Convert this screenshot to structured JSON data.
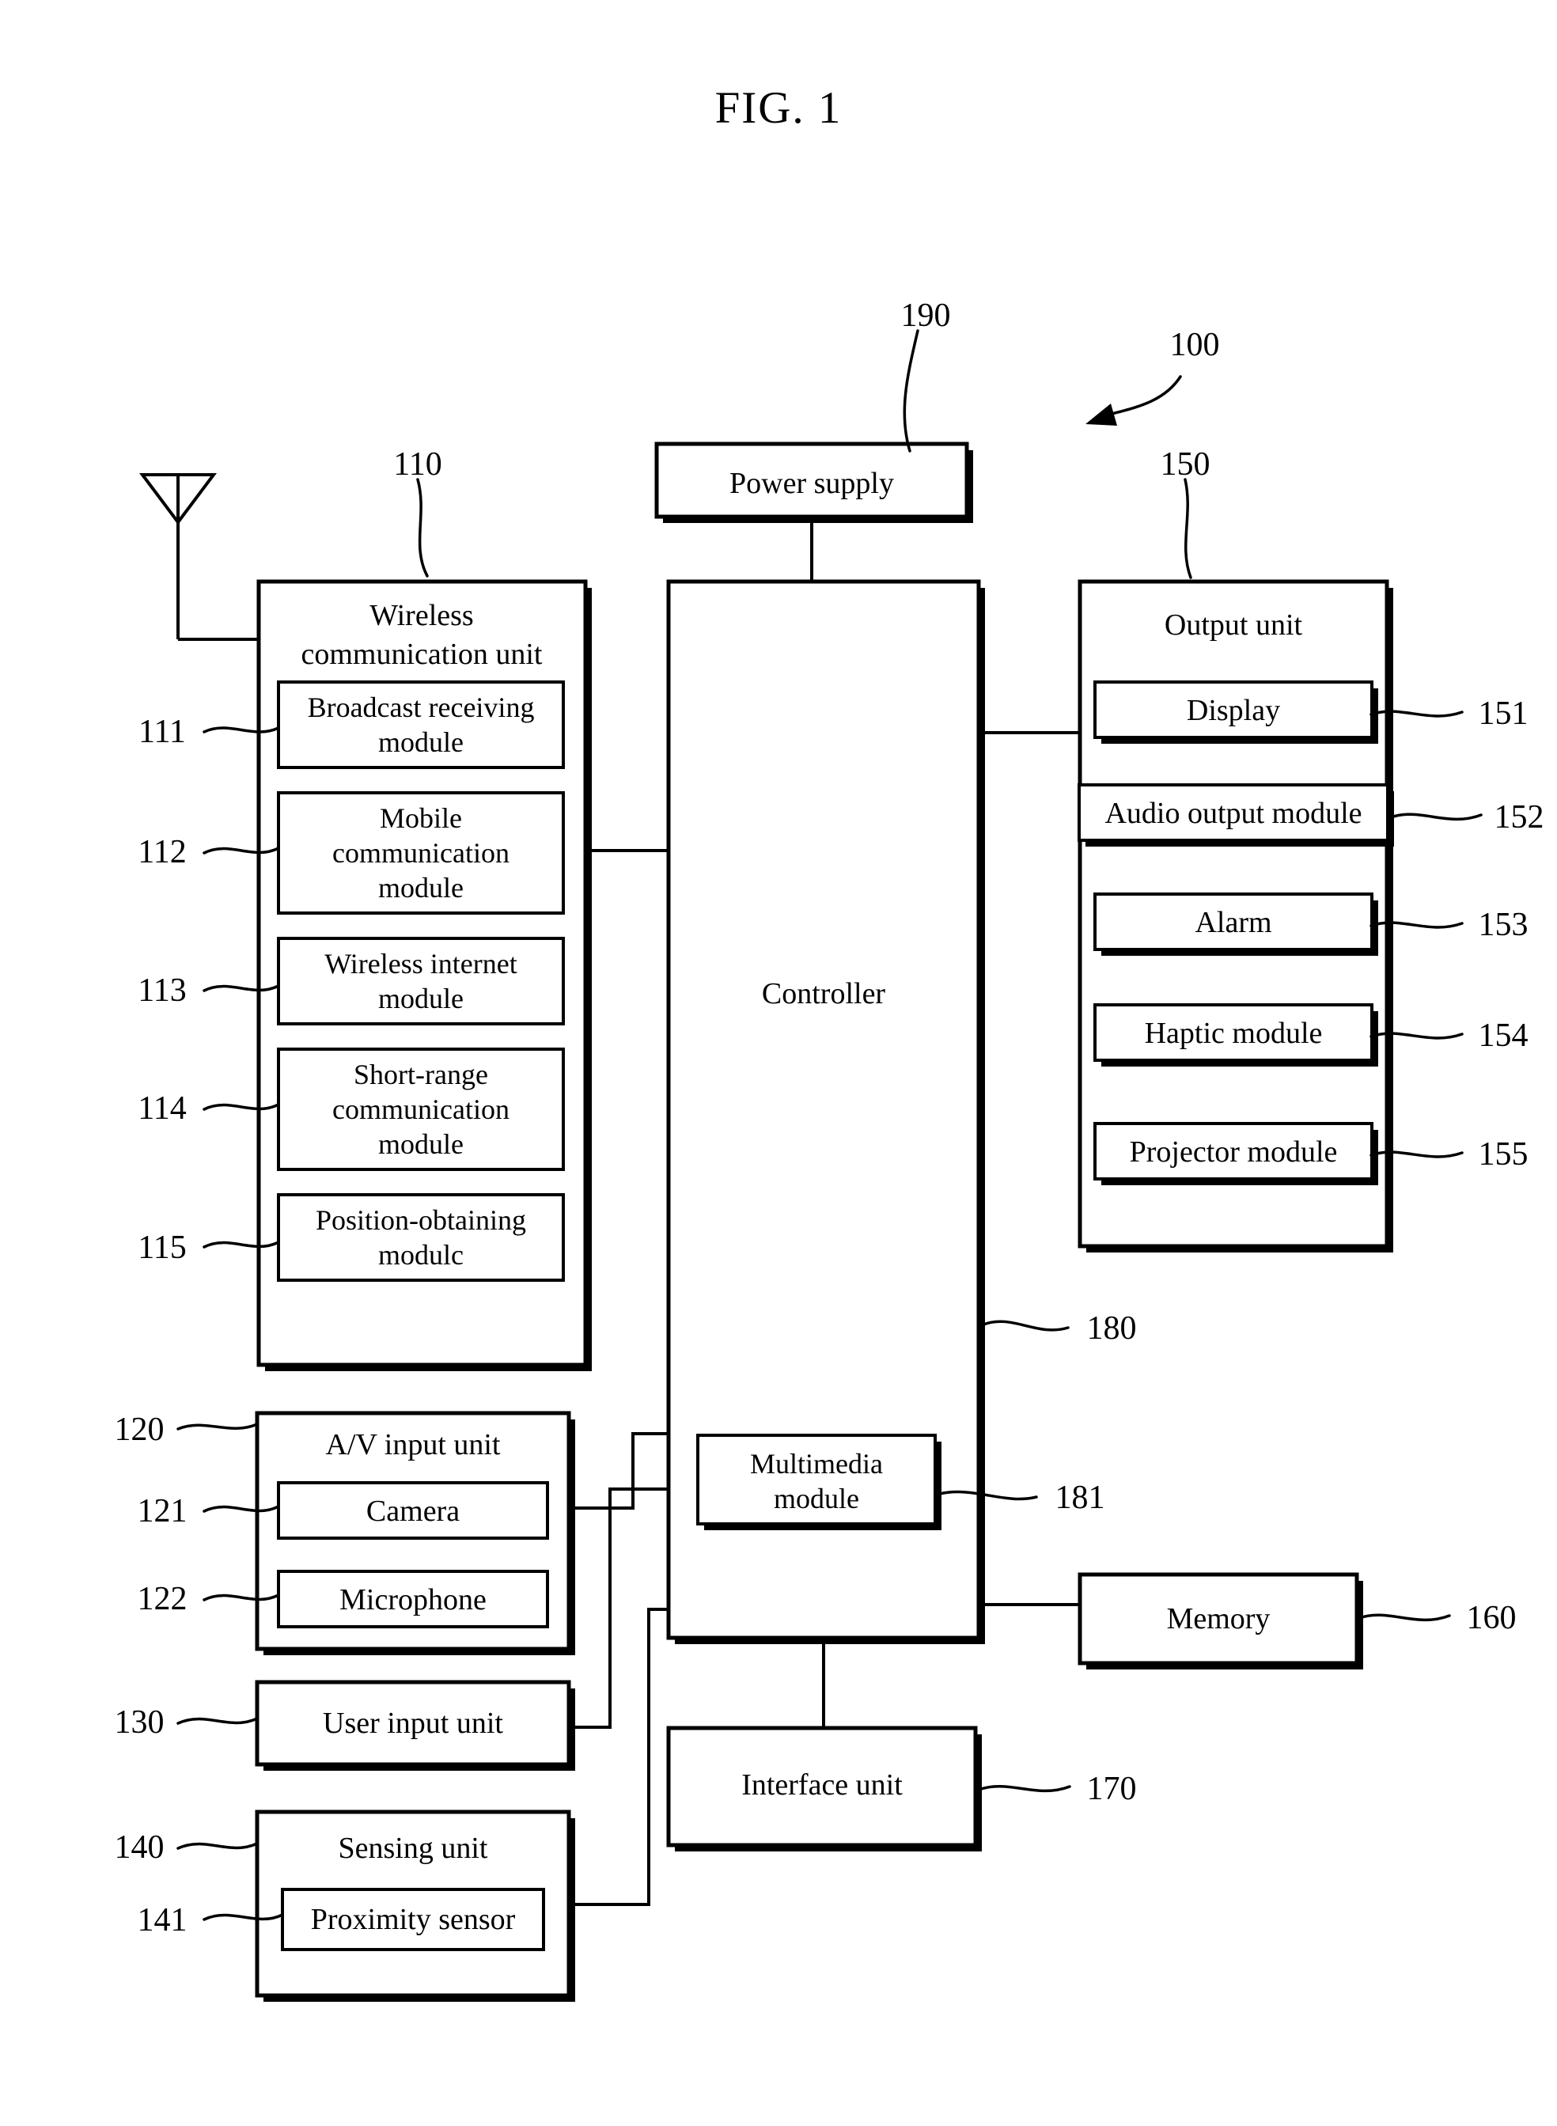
{
  "figure": {
    "title": "FIG. 1",
    "device_ref": "100"
  },
  "blocks": {
    "power_supply": {
      "label": "Power supply",
      "ref": "190"
    },
    "controller": {
      "label": "Controller",
      "ref": "180"
    },
    "multimedia_module": {
      "label": "Multimedia\nmodule",
      "line1": "Multimedia",
      "line2": "module",
      "ref": "181"
    },
    "memory": {
      "label": "Memory",
      "ref": "160"
    },
    "interface_unit": {
      "label": "Interface unit",
      "ref": "170"
    },
    "user_input_unit": {
      "label": "User input unit",
      "ref": "130"
    }
  },
  "wireless_communication_unit": {
    "title_line1": "Wireless",
    "title_line2": "communication unit",
    "ref": "110",
    "modules": [
      {
        "ref": "111",
        "line1": "Broadcast receiving",
        "line2": "module",
        "line3": ""
      },
      {
        "ref": "112",
        "line1": "Mobile",
        "line2": "communication",
        "line3": "module"
      },
      {
        "ref": "113",
        "line1": "Wireless internet",
        "line2": "module",
        "line3": ""
      },
      {
        "ref": "114",
        "line1": "Short-range",
        "line2": "communication",
        "line3": "module"
      },
      {
        "ref": "115",
        "line1": "Position-obtaining",
        "line2": "modulc",
        "line3": ""
      }
    ]
  },
  "output_unit": {
    "title": "Output unit",
    "ref": "150",
    "modules": [
      {
        "ref": "151",
        "label": "Display"
      },
      {
        "ref": "152",
        "label": "Audio output module"
      },
      {
        "ref": "153",
        "label": "Alarm"
      },
      {
        "ref": "154",
        "label": "Haptic module"
      },
      {
        "ref": "155",
        "label": "Projector module"
      }
    ]
  },
  "av_input_unit": {
    "title": "A/V input unit",
    "ref": "120",
    "modules": [
      {
        "ref": "121",
        "label": "Camera"
      },
      {
        "ref": "122",
        "label": "Microphone"
      }
    ]
  },
  "sensing_unit": {
    "title": "Sensing unit",
    "ref": "140",
    "modules": [
      {
        "ref": "141",
        "label": "Proximity sensor"
      }
    ]
  },
  "icons": {
    "antenna": "antenna-icon",
    "device_arrow": "device-arrow-icon"
  },
  "colors": {
    "stroke": "#000000",
    "background": "#ffffff"
  }
}
